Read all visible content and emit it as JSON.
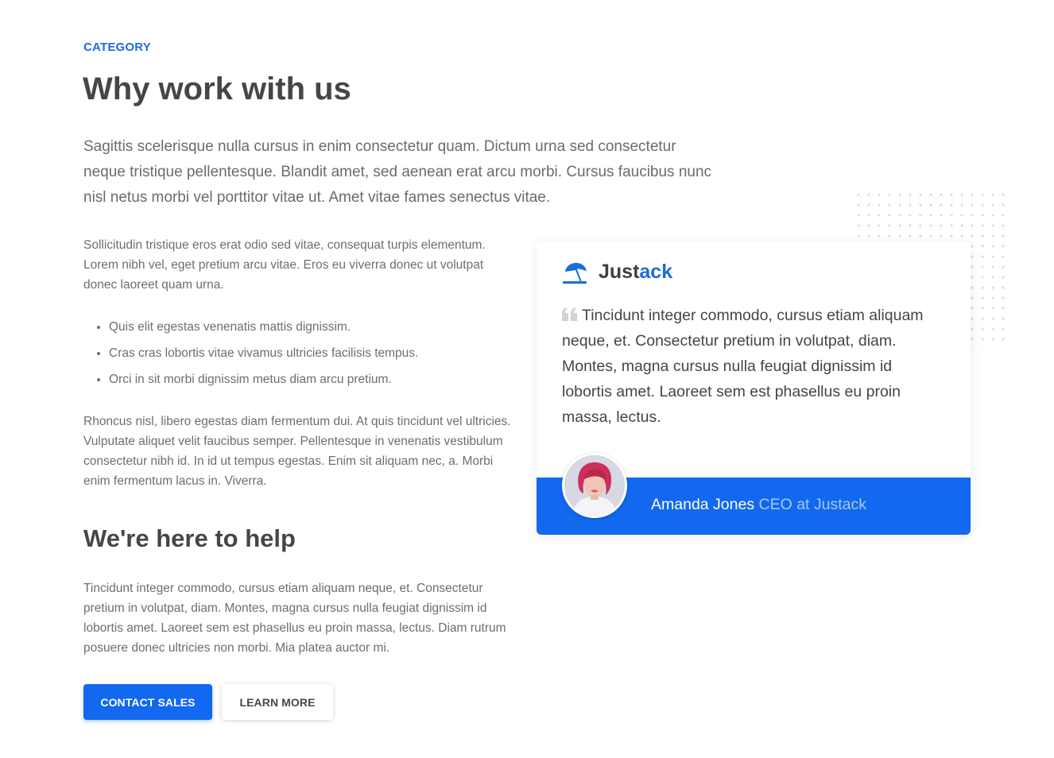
{
  "header": {
    "category": "CATEGORY",
    "title": "Why work with us",
    "lead": "Sagittis scelerisque nulla cursus in enim consectetur quam. Dictum urna sed consectetur neque tristique pellentesque. Blandit amet, sed aenean erat arcu morbi. Cursus faucibus nunc nisl netus morbi vel porttitor vitae ut. Amet vitae fames senectus vitae."
  },
  "content": {
    "intro": "Sollicitudin tristique eros erat odio sed vitae, consequat turpis elementum. Lorem nibh vel, eget pretium arcu vitae. Eros eu viverra donec ut volutpat donec laoreet quam urna.",
    "bullets": [
      "Quis elit egestas venenatis mattis dignissim.",
      "Cras cras lobortis vitae vivamus ultricies facilisis tempus.",
      "Orci in sit morbi dignissim metus diam arcu pretium."
    ],
    "closing": "Rhoncus nisl, libero egestas diam fermentum dui. At quis tincidunt vel ultricies. Vulputate aliquet velit faucibus semper. Pellentesque in venenatis vestibulum consectetur nibh id. In id ut tempus egestas. Enim sit aliquam nec, a. Morbi enim fermentum lacus in. Viverra."
  },
  "help": {
    "heading": "We're here to help",
    "body": "Tincidunt integer commodo, cursus etiam aliquam neque, et. Consectetur pretium in volutpat, diam. Montes, magna cursus nulla feugiat dignissim id lobortis amet. Laoreet sem est phasellus eu proin massa, lectus. Diam rutrum posuere donec ultricies non morbi. Mia platea auctor mi."
  },
  "actions": {
    "primary_label": "CONTACT SALES",
    "secondary_label": "LEARN MORE"
  },
  "testimonial": {
    "brand_icon": "umbrella-icon",
    "brand_prefix": "Just",
    "brand_suffix": "ack",
    "quote": "Tincidunt integer commodo, cursus etiam aliquam neque, et. Consectetur pretium in volutpat, diam. Montes, magna cursus nulla feugiat dignissim id lobortis amet. Laoreet sem est phasellus eu proin massa, lectus.",
    "author_name": "Amanda Jones",
    "author_role": "CEO at Justack"
  },
  "colors": {
    "accent": "#1268ef",
    "heading": "#464646",
    "body": "#6e6e6e"
  }
}
